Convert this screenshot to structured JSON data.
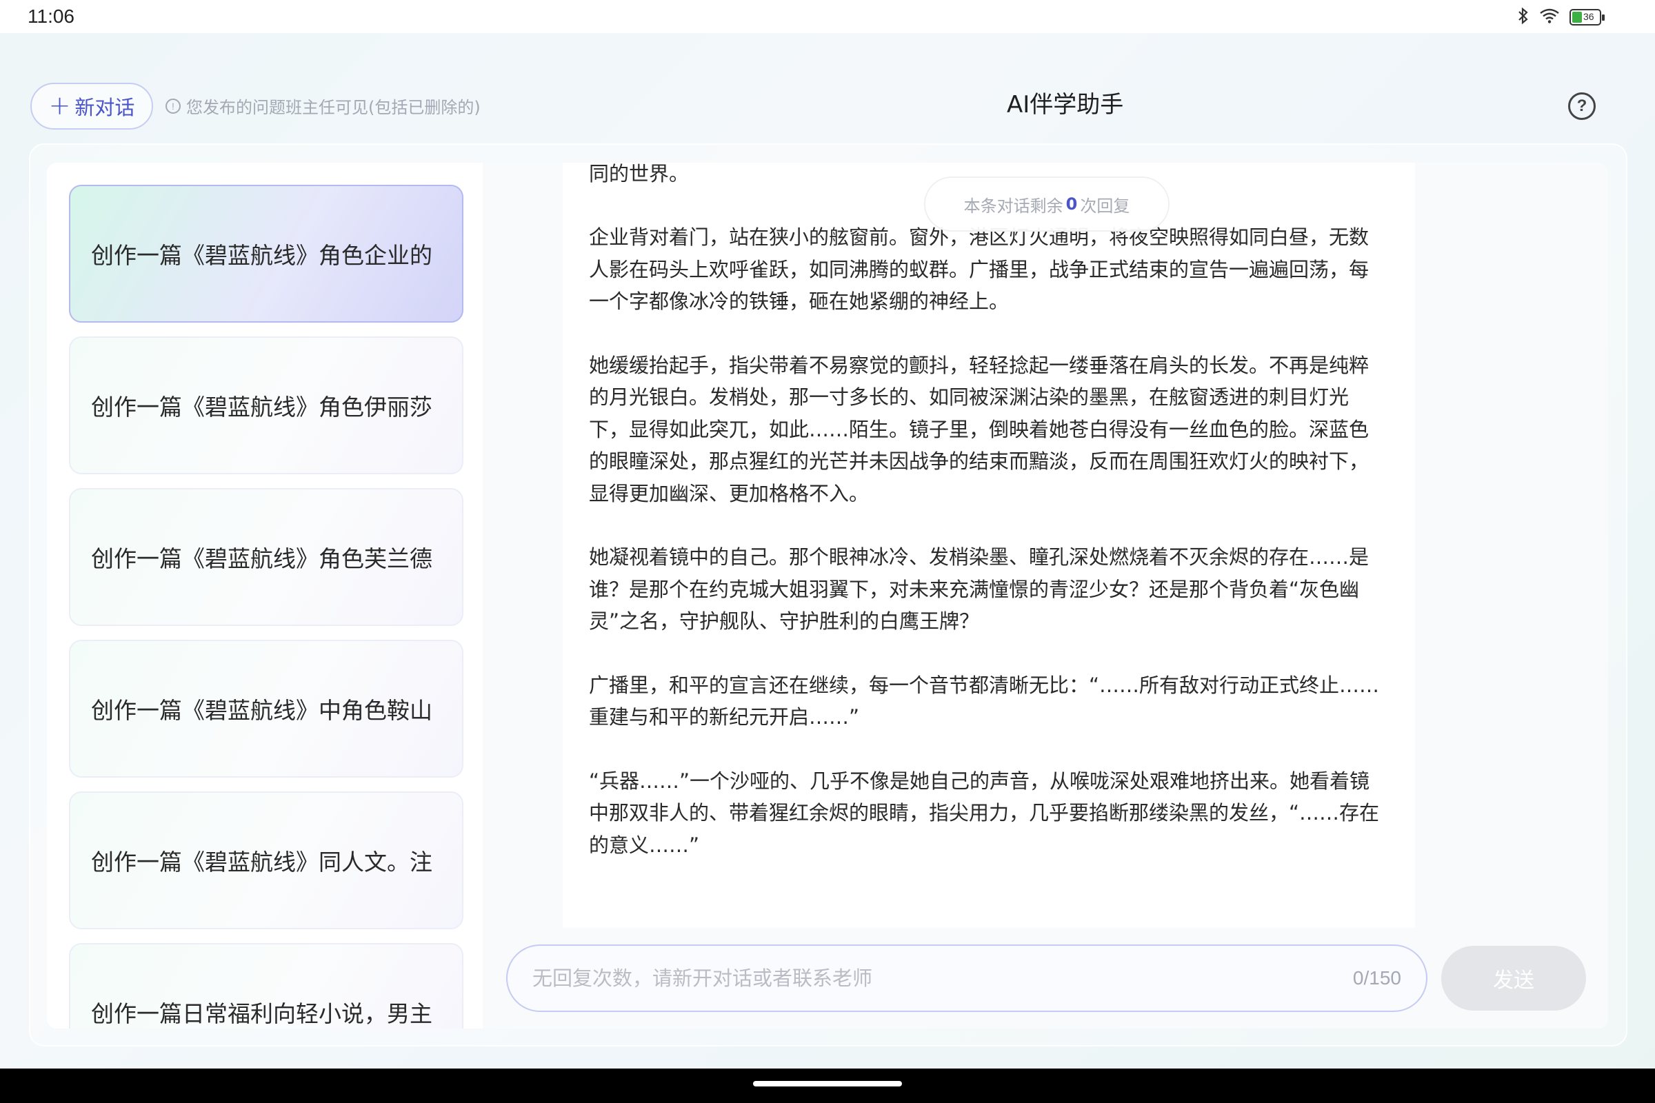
{
  "status_bar": {
    "time": "11:06",
    "battery_level": "36",
    "icons": [
      "bluetooth-icon",
      "wifi-icon",
      "battery-icon"
    ]
  },
  "header": {
    "new_chat_label": "新对话",
    "notice": "您发布的问题班主任可见(包括已删除的)",
    "title": "AI伴学助手"
  },
  "sidebar": {
    "items": [
      {
        "label": "创作一篇《碧蓝航线》角色企业的",
        "active": true
      },
      {
        "label": "创作一篇《碧蓝航线》角色伊丽莎",
        "active": false
      },
      {
        "label": "创作一篇《碧蓝航线》角色芙兰德",
        "active": false
      },
      {
        "label": "创作一篇《碧蓝航线》中角色鞍山",
        "active": false
      },
      {
        "label": "创作一篇《碧蓝航线》同人文。注",
        "active": false
      },
      {
        "label": "创作一篇日常福利向轻小说，男主",
        "active": false
      }
    ]
  },
  "chat": {
    "reply_notice_prefix": "本条对话剩余",
    "reply_notice_count": "0",
    "reply_notice_suffix": "次回复",
    "paragraphs": [
      "金属门板，试图渗透进去。门内，却是一片凝固的死寂，与远处的喧嚣形成了两个截然不同的世界。",
      "企业背对着门，站在狭小的舷窗前。窗外，港区灯火通明，将夜空映照得如同白昼，无数人影在码头上欢呼雀跃，如同沸腾的蚁群。广播里，战争正式结束的宣告一遍遍回荡，每一个字都像冰冷的铁锤，砸在她紧绷的神经上。",
      "她缓缓抬起手，指尖带着不易察觉的颤抖，轻轻捻起一缕垂落在肩头的长发。不再是纯粹的月光银白。发梢处，那一寸多长的、如同被深渊沾染的墨黑，在舷窗透进的刺目灯光下，显得如此突兀，如此……陌生。镜子里，倒映着她苍白得没有一丝血色的脸。深蓝色的眼瞳深处，那点猩红的光芒并未因战争的结束而黯淡，反而在周围狂欢灯火的映衬下，显得更加幽深、更加格格不入。",
      "她凝视着镜中的自己。那个眼神冰冷、发梢染墨、瞳孔深处燃烧着不灭余烬的存在……是谁？是那个在约克城大姐羽翼下，对未来充满憧憬的青涩少女？还是那个背负着“灰色幽灵”之名，守护舰队、守护胜利的白鹰王牌？",
      "广播里，和平的宣言还在继续，每一个音节都清晰无比：“……所有敌对行动正式终止……重建与和平的新纪元开启……”",
      "“兵器……”一个沙哑的、几乎不像是她自己的声音，从喉咙深处艰难地挤出来。她看着镜中那双非人的、带着猩红余烬的眼睛，指尖用力，几乎要掐断那缕染黑的发丝，“……存在的意义……”"
    ]
  },
  "composer": {
    "placeholder": "无回复次数，请新开对话或者联系老师",
    "char_count": "0/150",
    "send_label": "发送"
  }
}
